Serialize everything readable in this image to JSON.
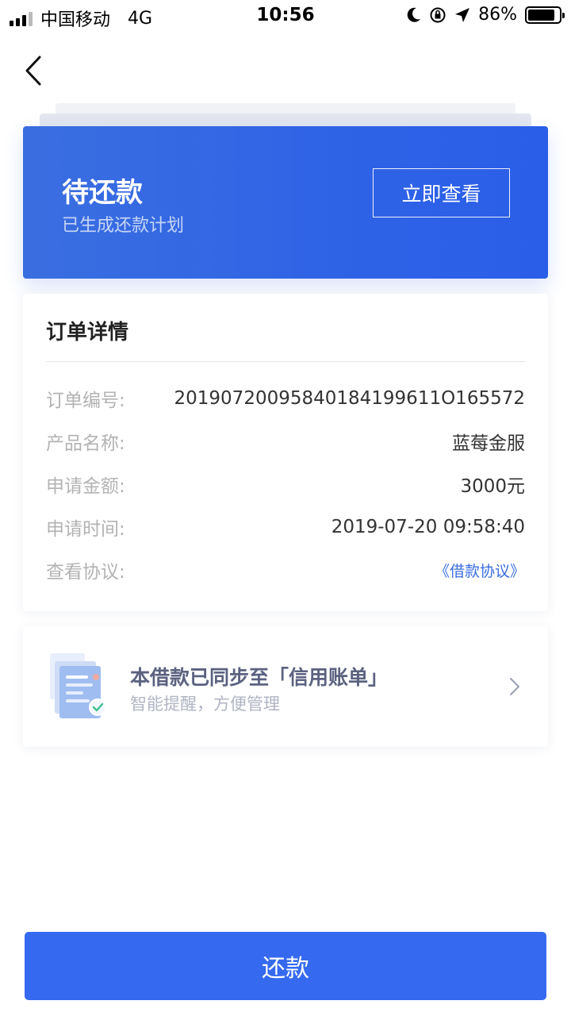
{
  "status_bar": {
    "carrier": "中国移动",
    "network": "4G",
    "time": "10:56",
    "battery": "86%",
    "battery_level": 0.86
  },
  "status_card": {
    "title": "待还款",
    "subtitle": "已生成还款计划",
    "view_button": "立即查看"
  },
  "detail": {
    "title": "订单详情",
    "rows": [
      {
        "label": "订单编号:",
        "value": "20190720095840184199611O165572"
      },
      {
        "label": "产品名称:",
        "value": "蓝莓金服"
      },
      {
        "label": "申请金额:",
        "value": "3000元"
      },
      {
        "label": "申请时间:",
        "value": "2019-07-20 09:58:40"
      },
      {
        "label": "查看协议:",
        "value": "《借款协议》"
      }
    ]
  },
  "sync": {
    "title": "本借款已同步至「信用账单」",
    "subtitle": "智能提醒，方便管理"
  },
  "repay_button": "还款",
  "colors": {
    "accent": "#3569f0",
    "card_blue": "#2f63e6",
    "link": "#3a6ee0"
  }
}
